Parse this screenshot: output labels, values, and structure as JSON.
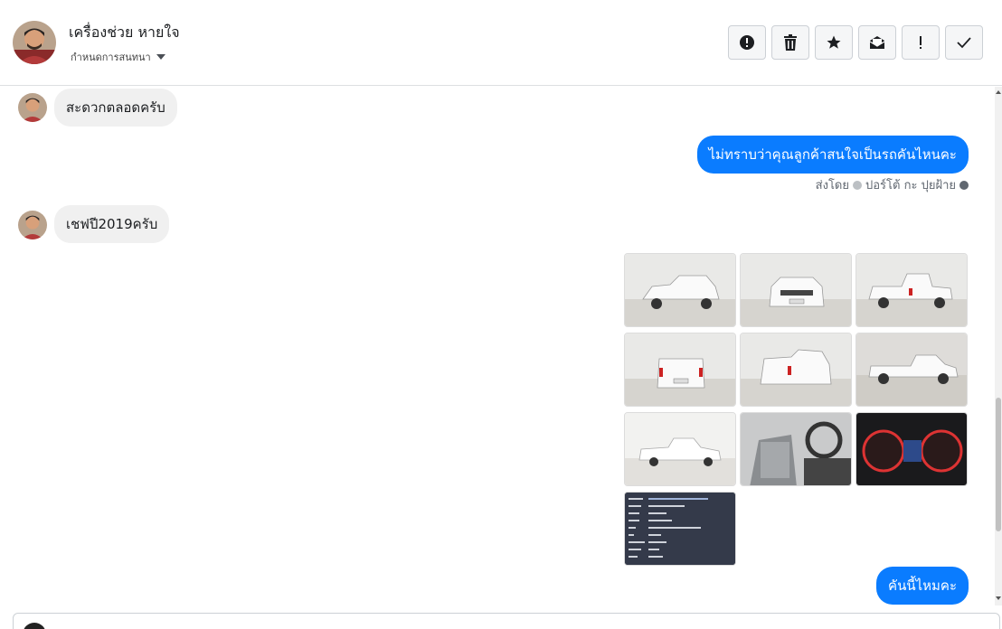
{
  "header": {
    "contact_name": "เครื่องช่วย หายใจ",
    "assign_label": "กำหนดการสนทนา",
    "actions": [
      {
        "name": "spam-button",
        "icon": "alert-circle-icon"
      },
      {
        "name": "delete-button",
        "icon": "trash-icon"
      },
      {
        "name": "star-button",
        "icon": "star-icon"
      },
      {
        "name": "unread-button",
        "icon": "envelope-icon"
      },
      {
        "name": "important-button",
        "icon": "exclamation-icon"
      },
      {
        "name": "done-button",
        "icon": "checkmark-icon"
      }
    ]
  },
  "messages": [
    {
      "from": "customer",
      "text": "สะดวกตลอดครับ"
    },
    {
      "from": "page",
      "text": "ไม่ทราบว่าคุณลูกค้าสนใจเป็นรถคันไหนคะ",
      "sent_by_prefix": "ส่งโดย",
      "sent_by_name": "ปอร์โต้ กะ ปุยฝ้าย"
    },
    {
      "from": "customer",
      "text": "เชฟปี2019ครับ"
    },
    {
      "from": "page",
      "type": "photos",
      "count": 10
    },
    {
      "from": "page",
      "text": "คันนี้ไหมคะ"
    }
  ],
  "colors": {
    "outgoing_bubble": "#0a7cff",
    "incoming_bubble": "#f0f0f0"
  }
}
